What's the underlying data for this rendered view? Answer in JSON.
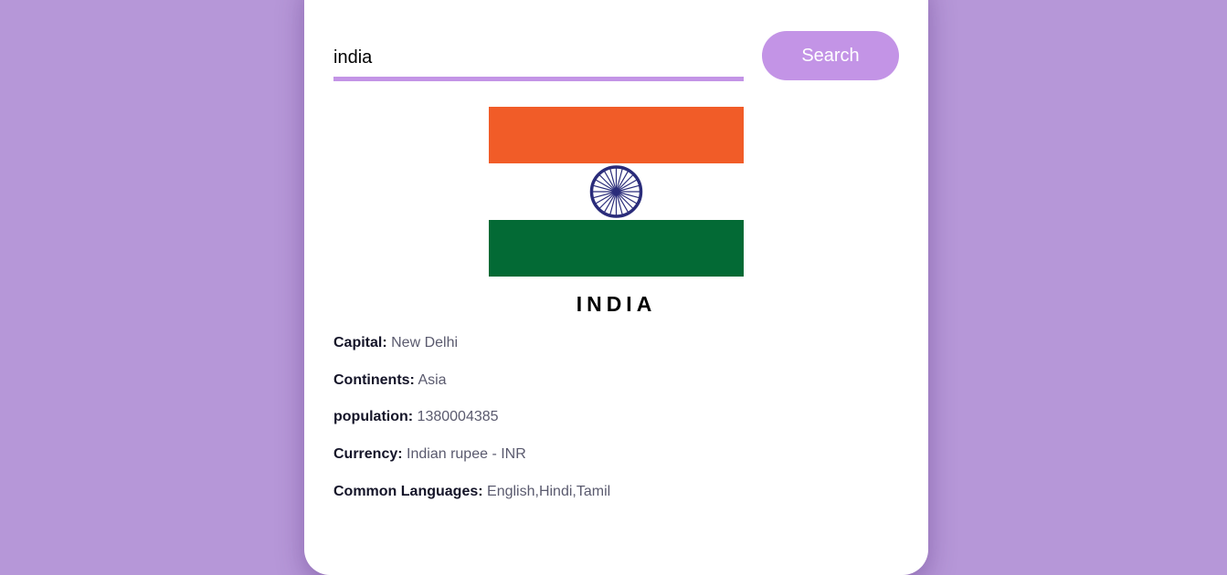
{
  "search": {
    "value": "india",
    "button_label": "Search"
  },
  "flag": {
    "icon": "india-flag",
    "colors": {
      "saffron": "#f15c28",
      "white": "#ffffff",
      "green": "#036a35",
      "chakra": "#2a2c7a"
    }
  },
  "country": {
    "name": "INDIA"
  },
  "facts": [
    {
      "label": "Capital:",
      "value": "New Delhi"
    },
    {
      "label": "Continents:",
      "value": "Asia"
    },
    {
      "label": "population:",
      "value": "1380004385"
    },
    {
      "label": "Currency:",
      "value": "Indian rupee - INR"
    },
    {
      "label": "Common Languages:",
      "value": "English,Hindi,Tamil"
    }
  ],
  "colors": {
    "background": "#b697d8",
    "accent": "#c394e6",
    "card": "#ffffff"
  }
}
